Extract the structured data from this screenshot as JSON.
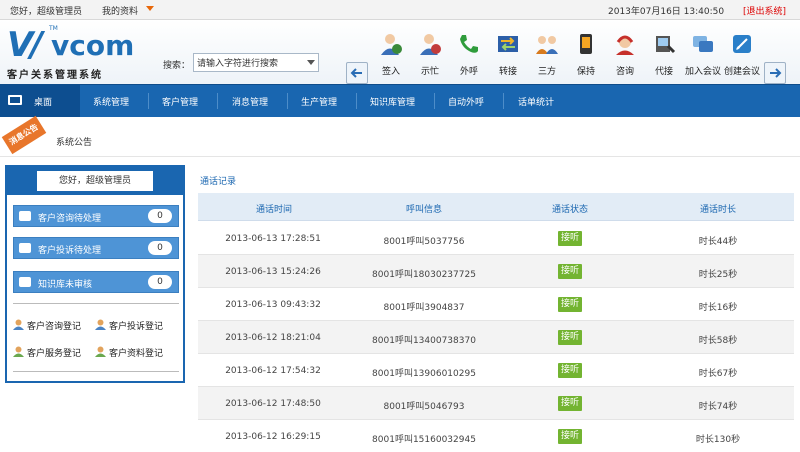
{
  "topbar": {
    "greeting": "您好，超级管理员",
    "profile": "我的资料",
    "datetime": "2013年07月16日 13:40:50",
    "logout": "[退出系统]"
  },
  "header": {
    "logo_text": "vcom",
    "logo_tm": "TM",
    "logo_subtitle": "客户关系管理系统",
    "search_label": "搜索：",
    "search_value": "请输入字符进行搜索"
  },
  "tools": [
    {
      "label": "签入",
      "icon": "agent-signin-icon",
      "color": "#3a8a3a"
    },
    {
      "label": "示忙",
      "icon": "agent-busy-icon",
      "color": "#c23b3b"
    },
    {
      "label": "外呼",
      "icon": "phone-call-icon",
      "color": "#2f9c3c"
    },
    {
      "label": "转接",
      "icon": "transfer-icon",
      "color": "#2c5fa8"
    },
    {
      "label": "三方",
      "icon": "conference-icon",
      "color": "#d77a1e"
    },
    {
      "label": "保持",
      "icon": "hold-icon",
      "color": "#333333"
    },
    {
      "label": "咨询",
      "icon": "headset-icon",
      "color": "#c6302b"
    },
    {
      "label": "代接",
      "icon": "pickup-icon",
      "color": "#555555"
    },
    {
      "label": "加入会议",
      "icon": "join-meeting-icon",
      "color": "#3a78c0"
    },
    {
      "label": "创建会议",
      "icon": "create-meeting-icon",
      "color": "#2a7fc9"
    }
  ],
  "mainnav": {
    "home": "桌面",
    "items": [
      "系统管理",
      "客户管理",
      "消息管理",
      "生产管理",
      "知识库管理",
      "自动外呼",
      "话单统计"
    ]
  },
  "notice": {
    "ribbon": "消息公告",
    "text": "系统公告"
  },
  "panel": {
    "greeting": "您好，超级管理员",
    "items": [
      {
        "label": "客户咨询待处理",
        "count": "0"
      },
      {
        "label": "客户投诉待处理",
        "count": "0"
      },
      {
        "label": "知识库未审核",
        "count": "0"
      }
    ],
    "links": [
      "客户咨询登记",
      "客户投诉登记",
      "客户服务登记",
      "客户资料登记"
    ]
  },
  "content": {
    "breadcrumb": "通话记录",
    "columns": [
      "通话时间",
      "呼叫信息",
      "通话状态",
      "通话时长"
    ],
    "rows": [
      {
        "time": "2013-06-13 17:28:51",
        "info": "8001呼叫5037756",
        "status": "接听",
        "duration": "时长44秒"
      },
      {
        "time": "2013-06-13 15:24:26",
        "info": "8001呼叫18030237725",
        "status": "接听",
        "duration": "时长25秒"
      },
      {
        "time": "2013-06-13 09:43:32",
        "info": "8001呼叫3904837",
        "status": "接听",
        "duration": "时长16秒"
      },
      {
        "time": "2013-06-12 18:21:04",
        "info": "8001呼叫13400738370",
        "status": "接听",
        "duration": "时长58秒"
      },
      {
        "time": "2013-06-12 17:54:32",
        "info": "8001呼叫13906010295",
        "status": "接听",
        "duration": "时长67秒"
      },
      {
        "time": "2013-06-12 17:48:50",
        "info": "8001呼叫5046793",
        "status": "接听",
        "duration": "时长74秒"
      },
      {
        "time": "2013-06-12 16:29:15",
        "info": "8001呼叫15160032945",
        "status": "接听",
        "duration": "时长130秒"
      }
    ]
  },
  "colors": {
    "nav_blue": "#1966b0",
    "badge_green": "#73b431",
    "logout_red": "#dd0000"
  }
}
